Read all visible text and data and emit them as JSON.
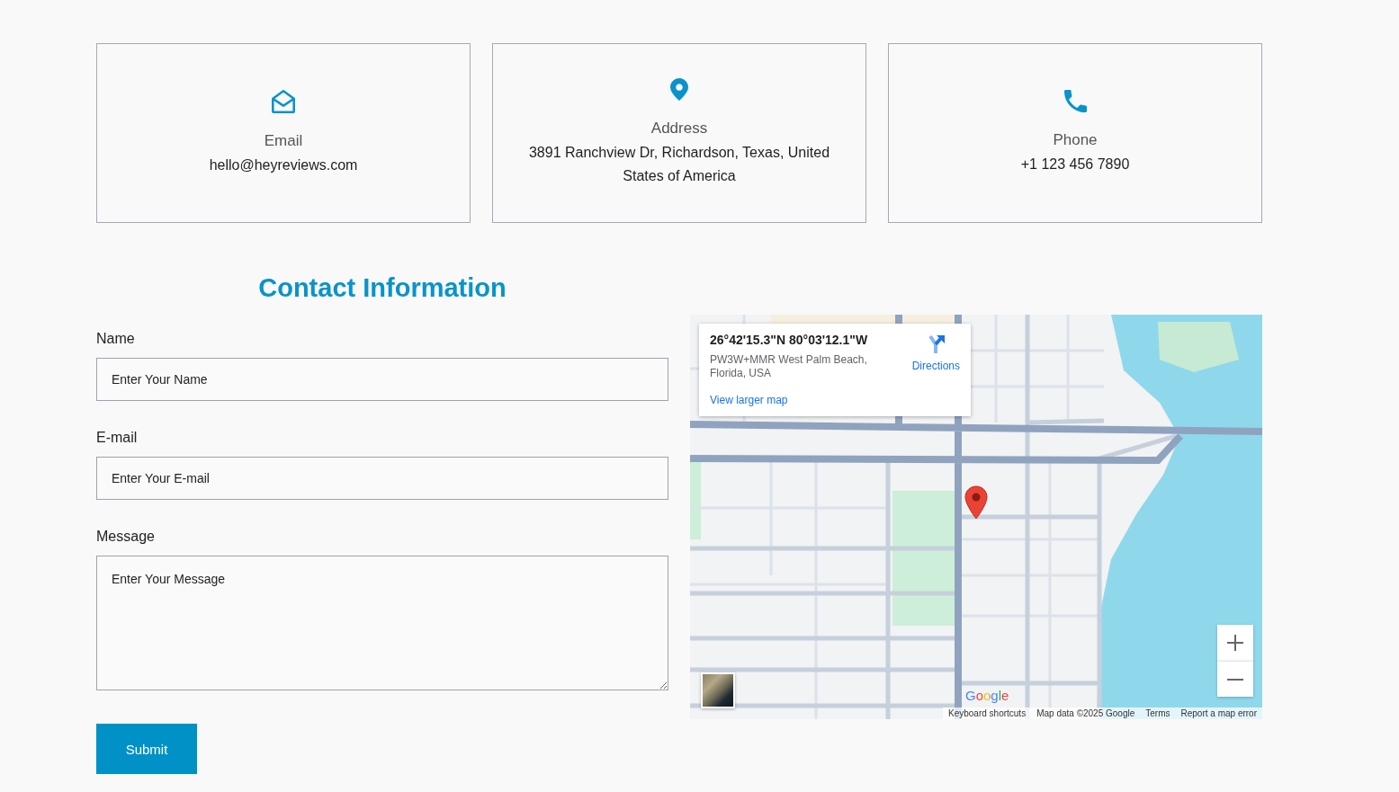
{
  "contact_cards": [
    {
      "kind": "email",
      "title": "Email",
      "value": "hello@heyreviews.com"
    },
    {
      "kind": "address",
      "title": "Address",
      "value": "3891 Ranchview Dr, Richardson, Texas, United States of America"
    },
    {
      "kind": "phone",
      "title": "Phone",
      "value": "+1 123 456 7890"
    }
  ],
  "contact_form": {
    "title": "Contact Information",
    "fields": [
      {
        "kind": "text",
        "label": "Name",
        "placeholder": "Enter Your Name"
      },
      {
        "kind": "text",
        "label": "E-mail",
        "placeholder": "Enter Your E-mail"
      },
      {
        "kind": "textarea",
        "label": "Message",
        "placeholder": "Enter Your Message"
      }
    ],
    "submit_button": "Submit"
  },
  "map": {
    "info_card": {
      "coordinates": "26°42'15.3\"N 80°03'12.1\"W",
      "address": "PW3W+MMR West Palm Beach, Florida, USA",
      "directions": "Directions",
      "larger_map_link": "View larger map"
    },
    "logo": "Google",
    "footer": [
      "Keyboard shortcuts",
      "Map data ©2025 Google",
      "Terms",
      "Report a map error"
    ]
  }
}
